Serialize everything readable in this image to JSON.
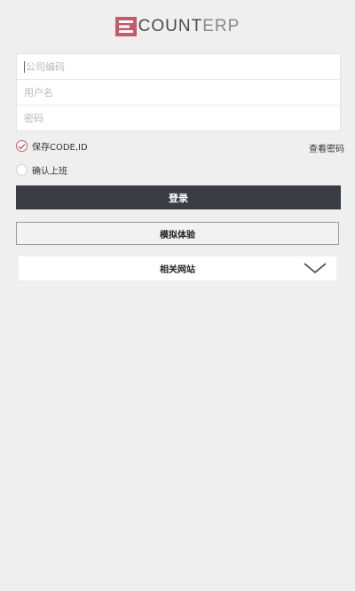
{
  "app": {
    "logo_text_main": "COUNT",
    "logo_text_suffix": "ERP",
    "brand_color": "#c65a6a"
  },
  "form": {
    "company_code_placeholder": "公司编码",
    "username_placeholder": "用户名",
    "password_placeholder": "密码"
  },
  "options": {
    "save_code_label": "保存CODE,ID",
    "save_code_checked": true,
    "confirm_work_label": "确认上班",
    "confirm_work_checked": false,
    "find_password_label": "查看密码"
  },
  "buttons": {
    "login_label": "登录",
    "demo_label": "模拟体验"
  },
  "related": {
    "label": "相关网站",
    "icon": "chevron-down-icon"
  }
}
